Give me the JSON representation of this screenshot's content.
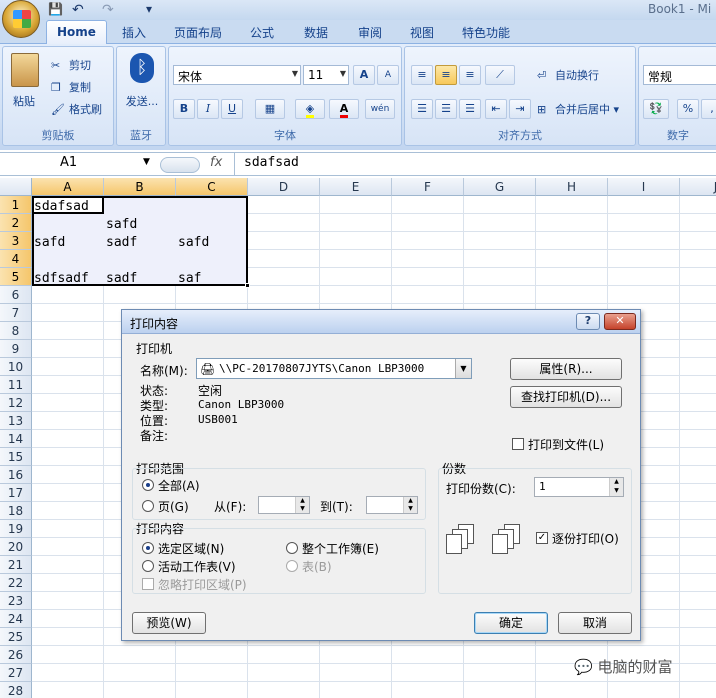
{
  "app": {
    "book_title": "Book1 - Mi"
  },
  "quick_access": {
    "save": "💾",
    "undo": "↶",
    "redo": "↷",
    "customize": "▾"
  },
  "tabs": [
    "Home",
    "插入",
    "页面布局",
    "公式",
    "数据",
    "审阅",
    "视图",
    "特色功能"
  ],
  "ribbon": {
    "clipboard": {
      "paste": "粘贴",
      "cut": "剪切",
      "copy": "复制",
      "format_painter": "格式刷",
      "label": "剪贴板"
    },
    "bluetooth": {
      "send": "发送...",
      "label": "蓝牙"
    },
    "font": {
      "name": "宋体",
      "size": "11",
      "bold": "B",
      "italic": "I",
      "underline": "U",
      "grow": "A",
      "shrink": "A",
      "wen": "wén",
      "label": "字体"
    },
    "alignment": {
      "wrap": "自动换行",
      "merge": "合并后居中",
      "label": "对齐方式"
    },
    "number": {
      "format": "常规",
      "label": "数字"
    }
  },
  "formula_bar": {
    "name_box": "A1",
    "fx": "fx",
    "value": "sdafsad"
  },
  "sheet": {
    "columns": [
      "A",
      "B",
      "C",
      "D",
      "E",
      "F",
      "G",
      "H",
      "I",
      "J"
    ],
    "rows": [
      "1",
      "2",
      "3",
      "4",
      "5",
      "6",
      "7",
      "8",
      "9",
      "10",
      "11",
      "12",
      "13",
      "14",
      "15",
      "16",
      "17",
      "18",
      "19",
      "20",
      "21",
      "22",
      "23",
      "24",
      "25",
      "26",
      "27",
      "28"
    ],
    "cells": {
      "a1": "sdafsad",
      "b2": "safd",
      "a3": "safd",
      "b3": "sadf",
      "c3": "safd",
      "a5": "sdfsadf",
      "b5": "sadf",
      "c5": "saf"
    }
  },
  "dialog": {
    "title": "打印内容",
    "help": "?",
    "close": "✕",
    "printer_group": "打印机",
    "name_label": "名称(M):",
    "printer_name": "\\\\PC-20170807JYTS\\Canon LBP3000",
    "properties_btn": "属性(R)...",
    "find_printer_btn": "查找打印机(D)...",
    "status_label": "状态:",
    "status_value": "空闲",
    "type_label": "类型:",
    "type_value": "Canon LBP3000",
    "location_label": "位置:",
    "location_value": "USB001",
    "comment_label": "备注:",
    "print_to_file": "打印到文件(L)",
    "range_group": "打印范围",
    "range_all": "全部(A)",
    "range_pages": "页(G)",
    "from_label": "从(F):",
    "to_label": "到(T):",
    "copies_group": "份数",
    "copies_label": "打印份数(C):",
    "copies_value": "1",
    "content_group": "打印内容",
    "content_selection": "选定区域(N)",
    "content_workbook": "整个工作簿(E)",
    "content_active": "活动工作表(V)",
    "content_table": "表(B)",
    "ignore_area": "忽略打印区域(P)",
    "collate": "逐份打印(O)",
    "preview_btn": "预览(W)",
    "ok_btn": "确定",
    "cancel_btn": "取消"
  },
  "watermark": "电脑的财富",
  "colors": {
    "accent": "#15428b",
    "selection_header": "#f5c66b"
  }
}
